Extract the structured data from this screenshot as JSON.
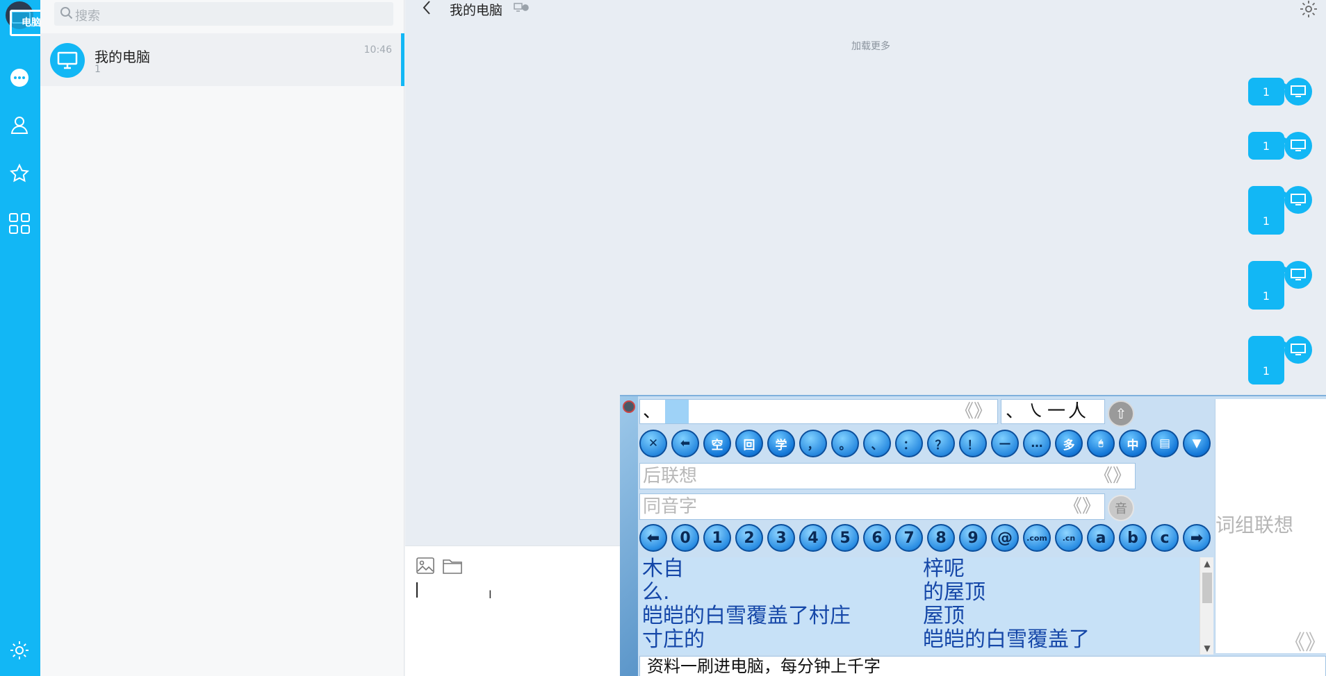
{
  "nav": {
    "avatar_label": "电脑",
    "icons": [
      "chat-icon",
      "contacts-icon",
      "favorites-icon",
      "apps-grid-icon",
      "settings-icon"
    ]
  },
  "search": {
    "placeholder": "搜索"
  },
  "conversations": [
    {
      "name": "我的电脑",
      "preview": "1",
      "time": "10:46"
    }
  ],
  "chat": {
    "title": "我的电脑",
    "load_more": "加载更多",
    "messages": [
      "1",
      "1",
      "1",
      "1",
      "1"
    ]
  },
  "ime": {
    "input_text": "、",
    "page_arrows": "《》",
    "strokes": "、㇏一人",
    "up_key": "⇧",
    "toolbar_keys": [
      "✕",
      "⬅",
      "空",
      "回",
      "学",
      "，",
      "。",
      "、",
      "：",
      "？",
      "！",
      "—",
      "…",
      "多",
      "🖱",
      "中",
      "▤",
      "▼"
    ],
    "assoc_after_label": "后联想",
    "homophone_label": "同音字",
    "yin_label": "音",
    "number_keys": [
      "⬅",
      "0",
      "1",
      "2",
      "3",
      "4",
      "5",
      "6",
      "7",
      "8",
      "9",
      "@",
      ".com",
      ".cn",
      "a",
      "b",
      "c",
      "➡"
    ],
    "candidates_left": [
      "木自",
      "么.",
      "皑皑的白雪覆盖了村庄",
      "寸庄的"
    ],
    "candidates_right": [
      "梓呢",
      "的屋顶",
      "屋顶",
      "皑皑的白雪覆盖了"
    ],
    "group_assoc_label": "词组联想",
    "bottom_text": "资料一刷进电脑，每分钟上千字"
  },
  "colors": {
    "accent": "#12b7f5",
    "ime_key": "#1478d8",
    "ime_bg": "#c9dff3"
  }
}
